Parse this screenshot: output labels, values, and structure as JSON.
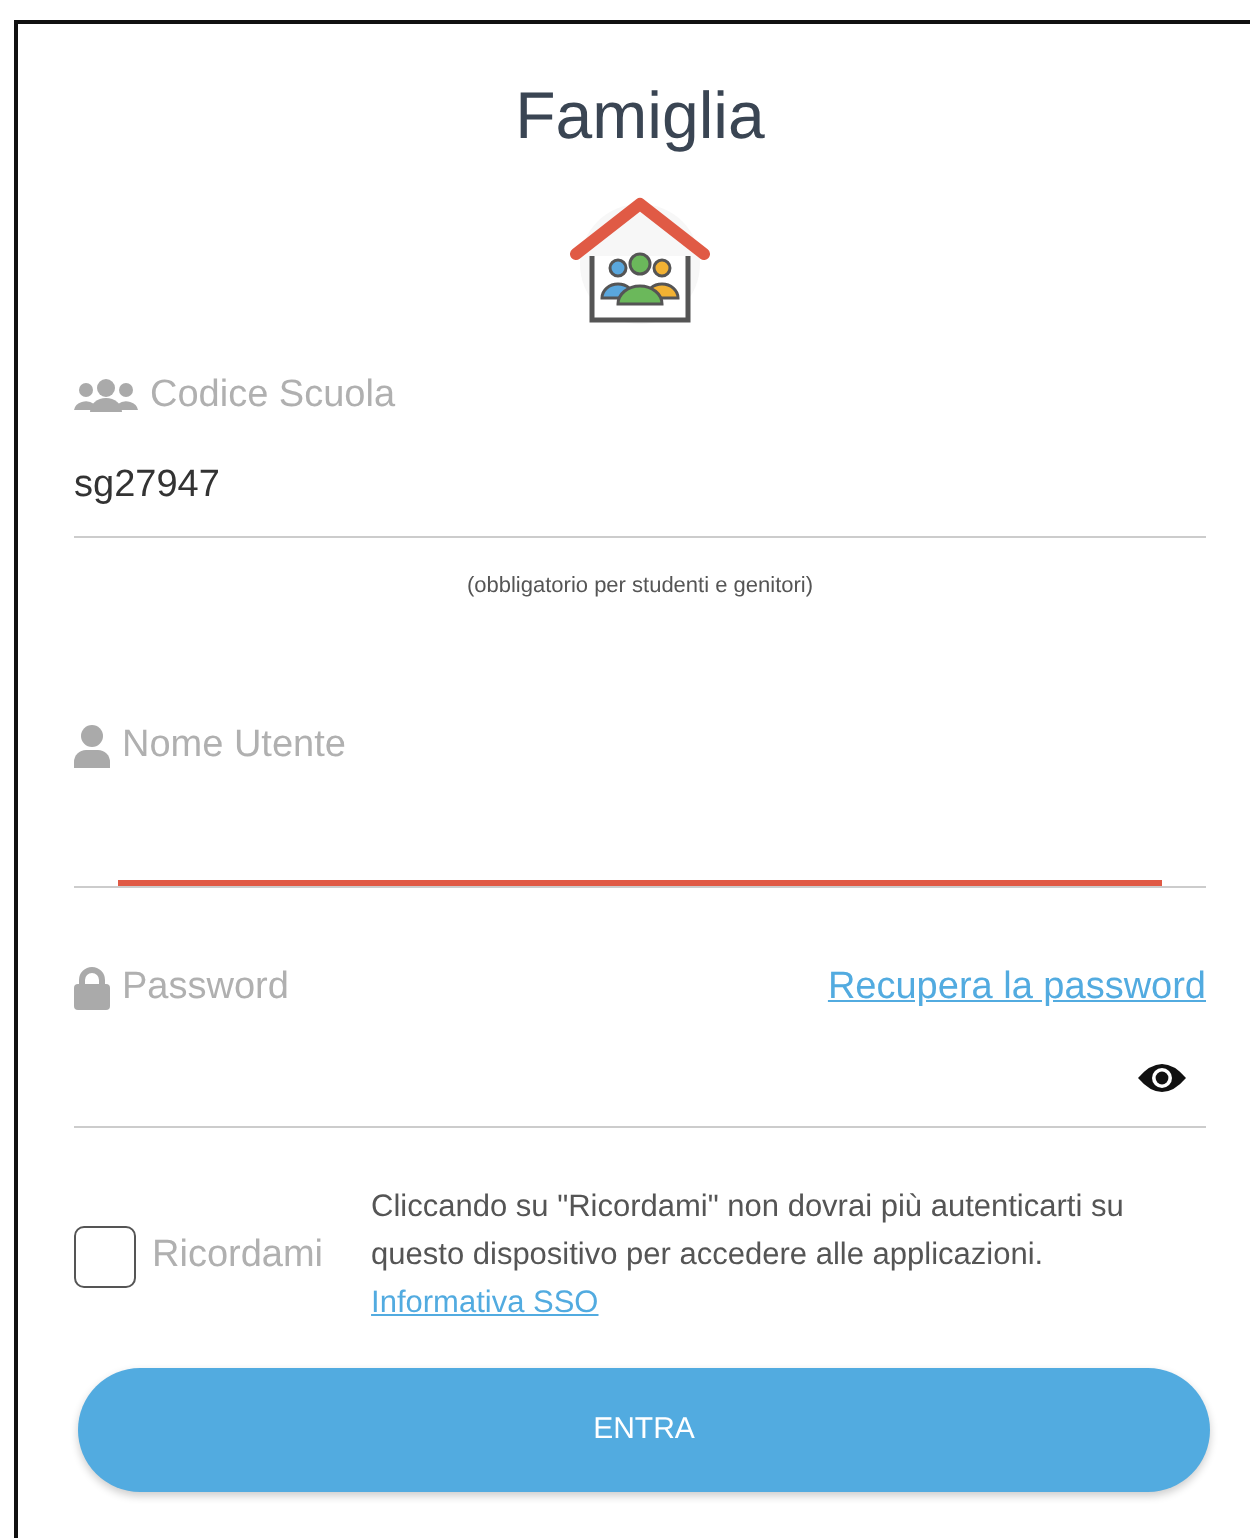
{
  "title": "Famiglia",
  "fields": [
    {
      "kind": "text",
      "label": "Codice Scuola",
      "value": "sg27947",
      "focused": false,
      "hint": "(obbligatorio per studenti e genitori)"
    },
    {
      "kind": "text",
      "label": "Nome Utente",
      "focused": true
    },
    {
      "kind": "password",
      "label": "Password",
      "focused": false,
      "link": "Recupera la password"
    }
  ],
  "remember": {
    "label": "Ricordami",
    "checked": false,
    "notice": "Cliccando su \"Ricordami\" non dovrai più autenticarti su questo dispositivo per accedere alle applicazioni.",
    "link": "Informativa SSO"
  },
  "submit": "ENTRA"
}
